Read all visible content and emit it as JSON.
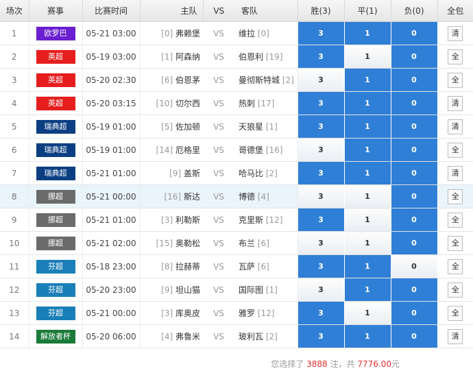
{
  "headers": {
    "idx": "场次",
    "league": "赛事",
    "time": "比赛时间",
    "home": "主队",
    "vs": "VS",
    "away": "客队",
    "win": "胜(3)",
    "draw": "平(1)",
    "lose": "负(0)",
    "all": "全包"
  },
  "colors": {
    "selected": "#2f7fd6",
    "highlight_row": "#eaf4fb",
    "amount": "#e03030"
  },
  "rows": [
    {
      "idx": "1",
      "league": "欧罗巴",
      "color": "#6a1fd0",
      "time": "05-21 03:00",
      "home_rank": "[0]",
      "home": "弗赖堡",
      "vs": "VS",
      "away": "维拉",
      "away_rank": "[0]",
      "w": "3",
      "d": "1",
      "l": "0",
      "sel": [
        true,
        true,
        true
      ],
      "pk": "清"
    },
    {
      "idx": "2",
      "league": "英超",
      "color": "#e61e1e",
      "time": "05-19 03:00",
      "home_rank": "[1]",
      "home": "阿森纳",
      "vs": "VS",
      "away": "伯恩利",
      "away_rank": "[19]",
      "w": "3",
      "d": "1",
      "l": "0",
      "sel": [
        true,
        false,
        true
      ],
      "pk": "全"
    },
    {
      "idx": "3",
      "league": "英超",
      "color": "#e61e1e",
      "time": "05-20 02:30",
      "home_rank": "[6]",
      "home": "伯恩茅",
      "vs": "VS",
      "away": "曼彻斯特城",
      "away_rank": "[2]",
      "w": "3",
      "d": "1",
      "l": "0",
      "sel": [
        false,
        true,
        true
      ],
      "pk": "全"
    },
    {
      "idx": "4",
      "league": "英超",
      "color": "#e61e1e",
      "time": "05-20 03:15",
      "home_rank": "[10]",
      "home": "切尔西",
      "vs": "VS",
      "away": "热刺",
      "away_rank": "[17]",
      "w": "3",
      "d": "1",
      "l": "0",
      "sel": [
        true,
        true,
        true
      ],
      "pk": "清"
    },
    {
      "idx": "5",
      "league": "瑞典超",
      "color": "#0b3f82",
      "time": "05-19 01:00",
      "home_rank": "[5]",
      "home": "佐加顿",
      "vs": "VS",
      "away": "天狼星",
      "away_rank": "[1]",
      "w": "3",
      "d": "1",
      "l": "0",
      "sel": [
        true,
        true,
        true
      ],
      "pk": "清"
    },
    {
      "idx": "6",
      "league": "瑞典超",
      "color": "#0b3f82",
      "time": "05-19 01:00",
      "home_rank": "[14]",
      "home": "厄格里",
      "vs": "VS",
      "away": "哥德堡",
      "away_rank": "[16]",
      "w": "3",
      "d": "1",
      "l": "0",
      "sel": [
        false,
        true,
        true
      ],
      "pk": "全"
    },
    {
      "idx": "7",
      "league": "瑞典超",
      "color": "#0b3f82",
      "time": "05-21 01:00",
      "home_rank": "[9]",
      "home": "盖斯",
      "vs": "VS",
      "away": "哈马比",
      "away_rank": "[2]",
      "w": "3",
      "d": "1",
      "l": "0",
      "sel": [
        true,
        true,
        true
      ],
      "pk": "清"
    },
    {
      "idx": "8",
      "league": "挪超",
      "color": "#6b6b6b",
      "time": "05-21 00:00",
      "home_rank": "[16]",
      "home": "斯达",
      "vs": "VS",
      "away": "博德",
      "away_rank": "[4]",
      "w": "3",
      "d": "1",
      "l": "0",
      "sel": [
        false,
        false,
        true
      ],
      "pk": "全"
    },
    {
      "idx": "9",
      "league": "挪超",
      "color": "#6b6b6b",
      "time": "05-21 01:00",
      "home_rank": "[3]",
      "home": "利勒斯",
      "vs": "VS",
      "away": "克里斯",
      "away_rank": "[12]",
      "w": "3",
      "d": "1",
      "l": "0",
      "sel": [
        true,
        false,
        true
      ],
      "pk": "全"
    },
    {
      "idx": "10",
      "league": "挪超",
      "color": "#6b6b6b",
      "time": "05-21 02:00",
      "home_rank": "[15]",
      "home": "奥勒松",
      "vs": "VS",
      "away": "布兰",
      "away_rank": "[6]",
      "w": "3",
      "d": "1",
      "l": "0",
      "sel": [
        false,
        false,
        true
      ],
      "pk": "全"
    },
    {
      "idx": "11",
      "league": "芬超",
      "color": "#1a7fb8",
      "time": "05-18 23:00",
      "home_rank": "[8]",
      "home": "拉赫蒂",
      "vs": "VS",
      "away": "瓦萨",
      "away_rank": "[6]",
      "w": "3",
      "d": "1",
      "l": "0",
      "sel": [
        true,
        true,
        false
      ],
      "pk": "全"
    },
    {
      "idx": "12",
      "league": "芬超",
      "color": "#1a7fb8",
      "time": "05-20 23:00",
      "home_rank": "[9]",
      "home": "坦山猫",
      "vs": "VS",
      "away": "国际图",
      "away_rank": "[1]",
      "w": "3",
      "d": "1",
      "l": "0",
      "sel": [
        false,
        true,
        true
      ],
      "pk": "全"
    },
    {
      "idx": "13",
      "league": "芬超",
      "color": "#1a7fb8",
      "time": "05-21 00:00",
      "home_rank": "[3]",
      "home": "库奥皮",
      "vs": "VS",
      "away": "雅罗",
      "away_rank": "[12]",
      "w": "3",
      "d": "1",
      "l": "0",
      "sel": [
        true,
        false,
        true
      ],
      "pk": "全"
    },
    {
      "idx": "14",
      "league": "解放者杯",
      "color": "#1a7a3a",
      "time": "05-20 06:00",
      "home_rank": "[4]",
      "home": "弗鲁米",
      "vs": "VS",
      "away": "玻利瓦",
      "away_rank": "[2]",
      "w": "3",
      "d": "1",
      "l": "0",
      "sel": [
        true,
        true,
        true
      ],
      "pk": "清"
    }
  ],
  "highlight_row_index": 7,
  "footer": {
    "prefix": "您选择了",
    "count": "3888",
    "mid": "注，共",
    "amount": "7776.00",
    "suffix": "元"
  }
}
